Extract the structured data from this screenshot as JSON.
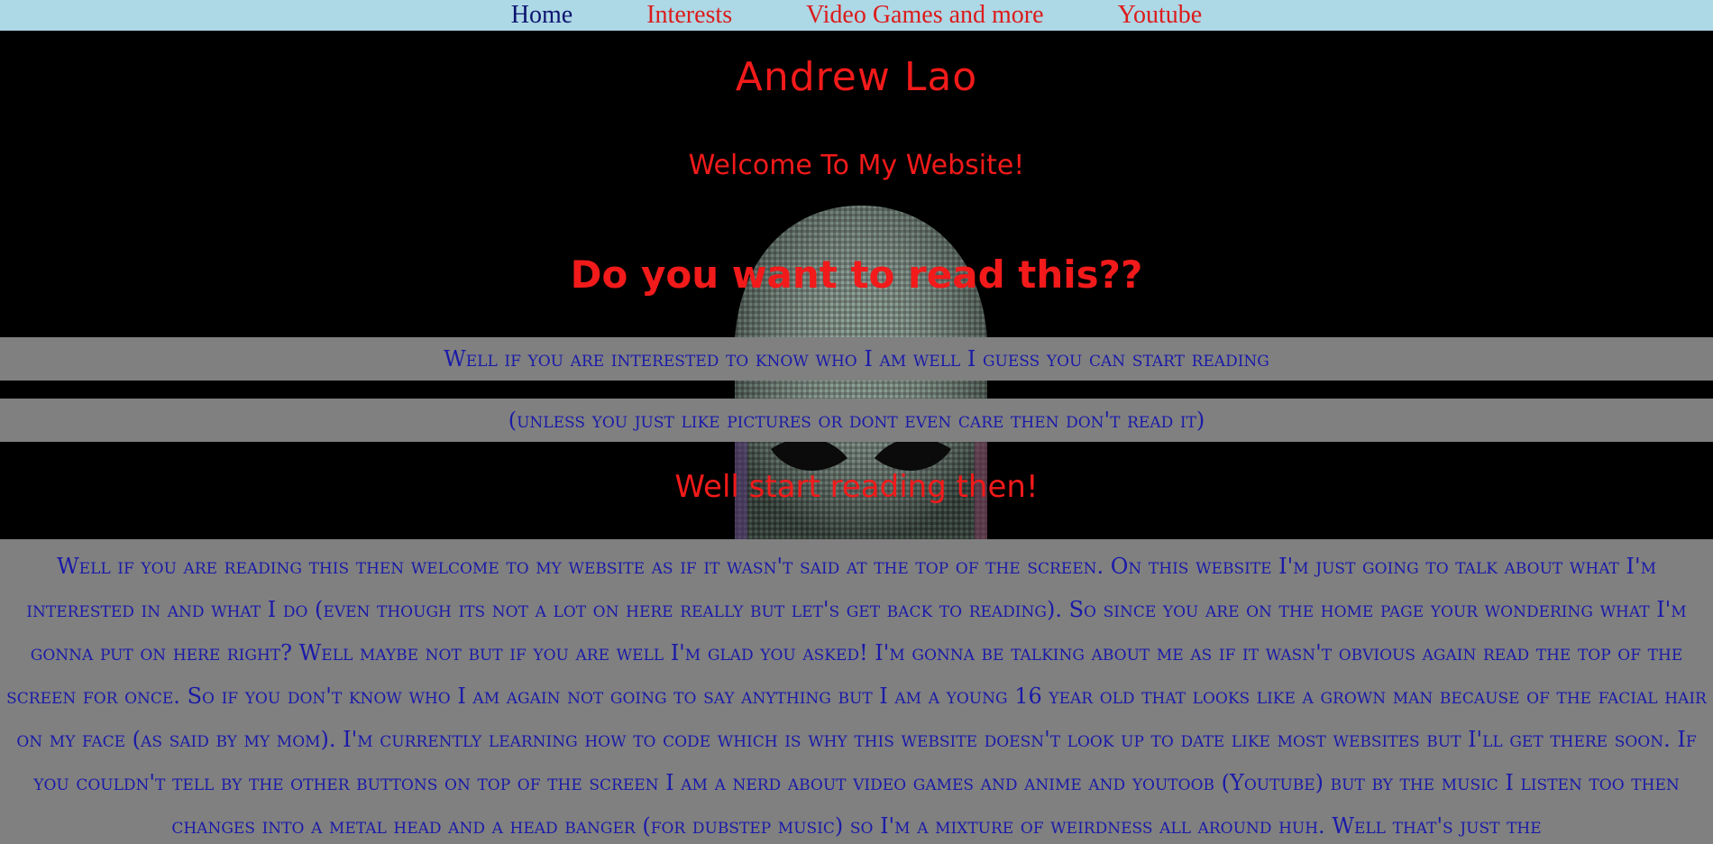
{
  "nav": {
    "items": [
      {
        "label": "Home",
        "active": true
      },
      {
        "label": "Interests",
        "active": false
      },
      {
        "label": "Video Games and more",
        "active": false
      },
      {
        "label": "Youtube",
        "active": false
      }
    ]
  },
  "header": {
    "title": "Andrew Lao",
    "welcome": "Welcome To My Website!",
    "question": "Do you want to read this??"
  },
  "intro": {
    "line1": "Well if you are interested to know who I am well I guess you can start reading",
    "line2": "(unless you just like pictures or dont even care then don't read it)",
    "start": "Well start reading then!"
  },
  "main": {
    "paragraph": "Well if you are reading this then welcome to my website as if it wasn't said at the top of the screen. On this website I'm just going to talk about what I'm interested in and what I do (even though its not a lot on here really but let's get back to reading). So since you are on the home page your wondering what I'm gonna put on here right? Well maybe not but if you are well I'm glad you asked! I'm gonna be talking about me as if it wasn't obvious again read the top of the screen for once. So if you don't know who I am again not going to say anything but I am a young 16 year old that looks like a grown man because of the facial hair on my face (as said by my mom). I'm currently learning how to code which is why this website doesn't look up to date like most websites but I'll get there soon. If you couldn't tell by the other buttons on top of the screen I am a nerd about video games and anime and youtoob (Youtube) but by the music I listen too then changes into a metal head and a head banger (for dubstep music) so I'm a mixture of weirdness all around huh. Well that's just the"
  },
  "colors": {
    "nav_bg": "#add8e6",
    "nav_active": "#0d1470",
    "nav_link": "#dc1c1c",
    "heading": "#f21a1a",
    "body_text": "#1a1aa8",
    "strip_bg": "#808080",
    "page_bg": "#000000"
  }
}
